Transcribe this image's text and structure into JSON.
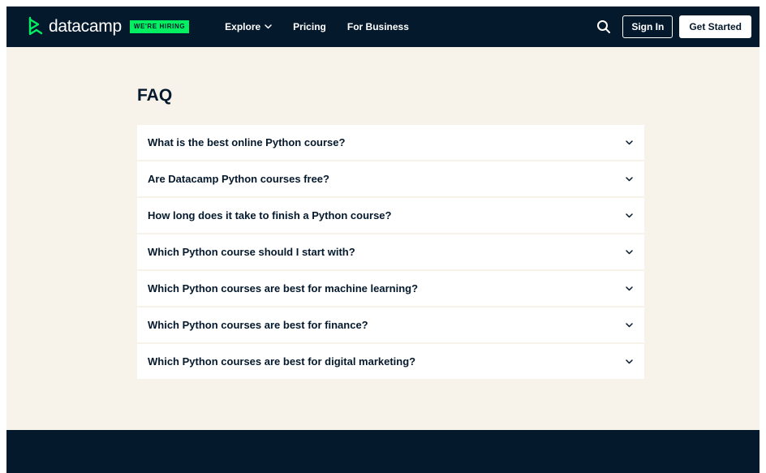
{
  "header": {
    "logo_text": "datacamp",
    "hiring_badge": "WE'RE HIRING",
    "nav": [
      {
        "label": "Explore",
        "has_dropdown": true
      },
      {
        "label": "Pricing",
        "has_dropdown": false
      },
      {
        "label": "For Business",
        "has_dropdown": false
      }
    ],
    "search_icon": "search-icon",
    "sign_in_label": "Sign In",
    "get_started_label": "Get Started"
  },
  "faq": {
    "title": "FAQ",
    "items": [
      {
        "question": "What is the best online Python course?"
      },
      {
        "question": "Are Datacamp Python courses free?"
      },
      {
        "question": "How long does it take to finish a Python course?"
      },
      {
        "question": "Which Python course should I start with?"
      },
      {
        "question": "Which Python courses are best for machine learning?"
      },
      {
        "question": "Which Python courses are best for finance?"
      },
      {
        "question": "Which Python courses are best for digital marketing?"
      }
    ]
  },
  "colors": {
    "navy": "#05192d",
    "brand_green": "#03ef62",
    "cream_bg": "#f7f3eb",
    "white": "#ffffff"
  }
}
